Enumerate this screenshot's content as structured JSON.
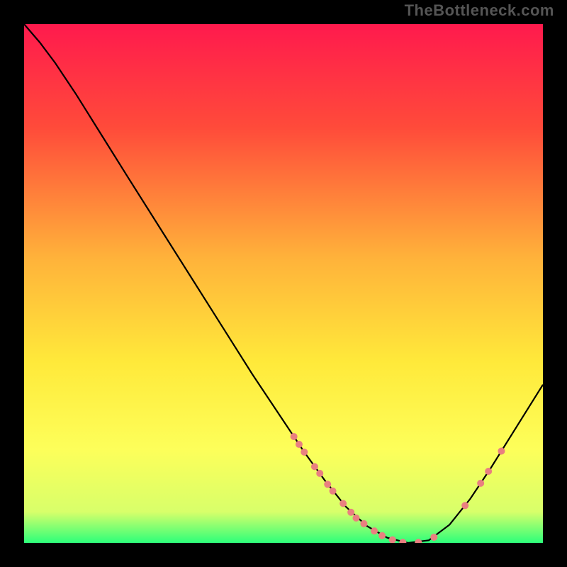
{
  "watermark": "TheBottleneck.com",
  "chart_data": {
    "type": "line",
    "title": "",
    "xlabel": "",
    "ylabel": "",
    "xlim": [
      0,
      100
    ],
    "ylim": [
      0,
      100
    ],
    "gradient_stops": [
      {
        "offset": 0,
        "color": "#ff1a4d"
      },
      {
        "offset": 20,
        "color": "#ff4b3a"
      },
      {
        "offset": 45,
        "color": "#ffb23a"
      },
      {
        "offset": 65,
        "color": "#ffe93a"
      },
      {
        "offset": 82,
        "color": "#fdff5a"
      },
      {
        "offset": 94,
        "color": "#d8ff6a"
      },
      {
        "offset": 100,
        "color": "#2dff7a"
      }
    ],
    "series": [
      {
        "name": "bottleneck-curve",
        "color": "#000000",
        "points": [
          {
            "x": 0.0,
            "y": 100.0
          },
          {
            "x": 3.0,
            "y": 96.5
          },
          {
            "x": 6.0,
            "y": 92.5
          },
          {
            "x": 10.0,
            "y": 86.5
          },
          {
            "x": 15.0,
            "y": 78.5
          },
          {
            "x": 20.0,
            "y": 70.5
          },
          {
            "x": 26.0,
            "y": 61.0
          },
          {
            "x": 32.0,
            "y": 51.5
          },
          {
            "x": 38.0,
            "y": 42.0
          },
          {
            "x": 44.0,
            "y": 32.5
          },
          {
            "x": 50.0,
            "y": 23.5
          },
          {
            "x": 54.0,
            "y": 17.5
          },
          {
            "x": 58.0,
            "y": 12.0
          },
          {
            "x": 62.0,
            "y": 7.0
          },
          {
            "x": 66.0,
            "y": 3.3
          },
          {
            "x": 70.0,
            "y": 1.0
          },
          {
            "x": 74.0,
            "y": 0.0
          },
          {
            "x": 78.0,
            "y": 0.5
          },
          {
            "x": 82.0,
            "y": 3.5
          },
          {
            "x": 86.0,
            "y": 8.5
          },
          {
            "x": 90.0,
            "y": 14.5
          },
          {
            "x": 95.0,
            "y": 22.5
          },
          {
            "x": 100.0,
            "y": 30.5
          }
        ]
      }
    ],
    "markers": {
      "name": "data-points",
      "color": "#e98080",
      "radius": 5,
      "points": [
        {
          "x": 52.0,
          "y": 20.5
        },
        {
          "x": 53.0,
          "y": 19.0
        },
        {
          "x": 54.0,
          "y": 17.5
        },
        {
          "x": 56.0,
          "y": 14.7
        },
        {
          "x": 57.0,
          "y": 13.4
        },
        {
          "x": 58.5,
          "y": 11.3
        },
        {
          "x": 59.5,
          "y": 10.0
        },
        {
          "x": 61.5,
          "y": 7.6
        },
        {
          "x": 63.0,
          "y": 5.9
        },
        {
          "x": 64.0,
          "y": 4.8
        },
        {
          "x": 65.5,
          "y": 3.7
        },
        {
          "x": 67.5,
          "y": 2.3
        },
        {
          "x": 69.0,
          "y": 1.4
        },
        {
          "x": 71.0,
          "y": 0.6
        },
        {
          "x": 73.0,
          "y": 0.1
        },
        {
          "x": 76.0,
          "y": 0.1
        },
        {
          "x": 79.0,
          "y": 1.1
        },
        {
          "x": 85.0,
          "y": 7.2
        },
        {
          "x": 88.0,
          "y": 11.5
        },
        {
          "x": 89.5,
          "y": 13.8
        },
        {
          "x": 92.0,
          "y": 17.7
        }
      ]
    }
  }
}
